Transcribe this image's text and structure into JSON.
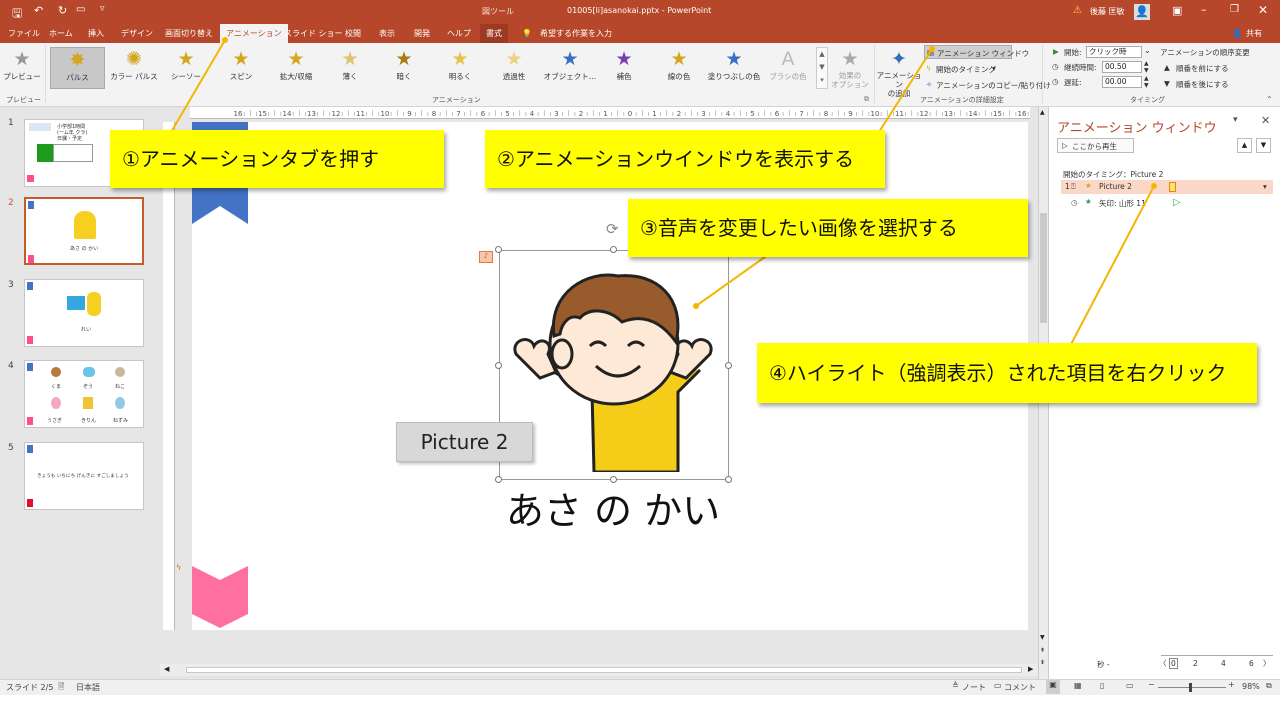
{
  "titlebar": {
    "doc": "01005[li]asanokai.pptx - PowerPoint",
    "context_tab": "図ツール",
    "user": "後藤 匡敏",
    "warn": "⚠"
  },
  "tabs": [
    "ファイル",
    "ホーム",
    "挿入",
    "デザイン",
    "画面切り替え",
    "アニメーション",
    "スライド ショー",
    "校閲",
    "表示",
    "開発",
    "ヘルプ",
    "書式"
  ],
  "tellme": "希望する作業を入力",
  "share": "共有",
  "ribbon": {
    "preview": "プレビュー",
    "preview_group": "プレビュー",
    "gallery": [
      "パルス",
      "カラー パルス",
      "シーソー",
      "スピン",
      "拡大/収縮",
      "薄く",
      "暗く",
      "明るく",
      "透過性",
      "オブジェクト…",
      "補色",
      "線の色",
      "塗りつぶしの色",
      "ブラシの色"
    ],
    "effect_options": "効果の\nオプション",
    "animation_group": "アニメーション",
    "add_animation": "アニメーション\nの追加",
    "animation_pane": "アニメーション ウィンドウ",
    "trigger": "開始のタイミング",
    "painter": "アニメーションのコピー/貼り付け",
    "advanced_group": "アニメーションの詳細設定",
    "start_label": "開始:",
    "start_value": "クリック時",
    "duration_label": "継続時間:",
    "duration_value": "00.50",
    "delay_label": "遅延:",
    "delay_value": "00.00",
    "reorder": "アニメーションの順序変更",
    "move_earlier": "順番を前にする",
    "move_later": "順番を後にする",
    "timing_group": "タイミング"
  },
  "thumbnails": [
    {
      "num": "1",
      "texts": [
        "小学部1時間",
        "(ーム年 クラ)",
        "日課・予定"
      ]
    },
    {
      "num": "2",
      "texts": [
        "あさ の かい"
      ]
    },
    {
      "num": "3",
      "texts": [
        "れい"
      ]
    },
    {
      "num": "4",
      "texts": [
        "くま",
        "ぞう",
        "ねこ",
        "うさぎ",
        "きりん",
        "ねずみ"
      ]
    },
    {
      "num": "5",
      "texts": [
        "きょうも いちにち げんきに すごしましょう"
      ]
    }
  ],
  "slide": {
    "caption": "あさ の かい",
    "picture_tooltip": "Picture 2"
  },
  "callouts": {
    "c1": "①アニメーションタブを押す",
    "c2": "②アニメーションウインドウを表示する",
    "c3": "③音声を変更したい画像を選択する",
    "c4": "④ハイライト（強調表示）された項目を右クリック"
  },
  "pane": {
    "title": "アニメーション ウィンドウ",
    "play": "ここから再生",
    "trigger_header": "開始のタイミング：Picture 2",
    "items": [
      {
        "num": "1",
        "name": "Picture 2"
      },
      {
        "num": "",
        "name": "矢印: 山形 11"
      }
    ],
    "seconds_label": "秒 -",
    "timeline": [
      "0",
      "2",
      "4",
      "6"
    ]
  },
  "status": {
    "slide": "スライド 2/5",
    "lang": "日本語",
    "notes": "ノート",
    "comments": "コメント",
    "zoom": "98%"
  },
  "colors": {
    "accent": "#b7472a",
    "callout": "#ffff00",
    "highlight": "#fbd7c7"
  },
  "ruler_labels": [
    "16",
    "15",
    "14",
    "13",
    "12",
    "11",
    "10",
    "9",
    "8",
    "7",
    "6",
    "5",
    "4",
    "3",
    "2",
    "1",
    "0",
    "1",
    "2",
    "3",
    "4",
    "5",
    "6",
    "7",
    "8",
    "9",
    "10",
    "11",
    "12",
    "13",
    "14",
    "15",
    "16"
  ]
}
